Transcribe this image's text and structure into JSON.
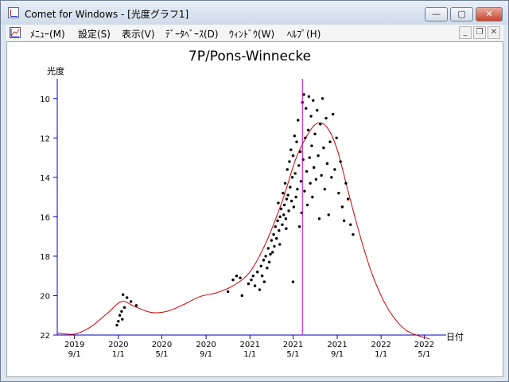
{
  "window": {
    "title": "Comet for Windows - [光度グラフ1]",
    "buttons": {
      "minimize": "—",
      "maximize": "▢",
      "close": "✕"
    }
  },
  "menubar": {
    "items": [
      "ﾒﾆｭｰ(M)",
      "設定(S)",
      "表示(V)",
      "ﾃﾞｰﾀﾍﾞｰｽ(D)",
      "ｳｨﾝﾄﾞｳ(W)",
      "ﾍﾙﾌﾟ(H)"
    ],
    "mdi_buttons": {
      "minimize": "_",
      "restore": "❐",
      "close": "✕"
    }
  },
  "chart_data": {
    "type": "scatter",
    "title": "7P/Pons-Winnecke",
    "ylabel": "光度",
    "xlabel": "日付",
    "y_inverted": true,
    "ylim": [
      22,
      9
    ],
    "y_ticks": [
      10,
      12,
      14,
      16,
      18,
      20,
      22
    ],
    "xlim": [
      "2019-07-15",
      "2022-07-01"
    ],
    "x_ticks": [
      {
        "date": "2019-09-01",
        "year": "2019",
        "md": "9/1"
      },
      {
        "date": "2020-01-01",
        "year": "2020",
        "md": "1/1"
      },
      {
        "date": "2020-05-01",
        "year": "2020",
        "md": "5/1"
      },
      {
        "date": "2020-09-01",
        "year": "2020",
        "md": "9/1"
      },
      {
        "date": "2021-01-01",
        "year": "2021",
        "md": "1/1"
      },
      {
        "date": "2021-05-01",
        "year": "2021",
        "md": "5/1"
      },
      {
        "date": "2021-09-01",
        "year": "2021",
        "md": "9/1"
      },
      {
        "date": "2022-01-01",
        "year": "2022",
        "md": "1/1"
      },
      {
        "date": "2022-05-01",
        "year": "2022",
        "md": "5/1"
      }
    ],
    "marker_line": {
      "date": "2021-05-27",
      "color": "#c000c0"
    },
    "curve_color": "#d00000",
    "axis_color": "#0000c0",
    "curve": [
      {
        "x": "2019-07-15",
        "y": 21.9
      },
      {
        "x": "2019-09-01",
        "y": 21.95
      },
      {
        "x": "2019-10-15",
        "y": 21.6
      },
      {
        "x": "2019-12-01",
        "y": 20.9
      },
      {
        "x": "2020-01-10",
        "y": 20.3
      },
      {
        "x": "2020-02-15",
        "y": 20.55
      },
      {
        "x": "2020-04-01",
        "y": 20.85
      },
      {
        "x": "2020-05-15",
        "y": 20.8
      },
      {
        "x": "2020-07-01",
        "y": 20.45
      },
      {
        "x": "2020-08-15",
        "y": 20.05
      },
      {
        "x": "2020-10-01",
        "y": 19.85
      },
      {
        "x": "2020-11-15",
        "y": 19.5
      },
      {
        "x": "2021-01-01",
        "y": 18.8
      },
      {
        "x": "2021-02-15",
        "y": 17.3
      },
      {
        "x": "2021-04-01",
        "y": 15.2
      },
      {
        "x": "2021-05-10",
        "y": 13.0
      },
      {
        "x": "2021-06-15",
        "y": 11.7
      },
      {
        "x": "2021-07-10",
        "y": 11.25
      },
      {
        "x": "2021-08-05",
        "y": 11.5
      },
      {
        "x": "2021-09-01",
        "y": 12.6
      },
      {
        "x": "2021-10-01",
        "y": 14.7
      },
      {
        "x": "2021-11-01",
        "y": 16.8
      },
      {
        "x": "2021-12-01",
        "y": 18.6
      },
      {
        "x": "2022-01-01",
        "y": 20.0
      },
      {
        "x": "2022-02-01",
        "y": 21.0
      },
      {
        "x": "2022-03-15",
        "y": 21.8
      },
      {
        "x": "2022-05-15",
        "y": 22.2
      }
    ],
    "points": [
      [
        "2020-01-01",
        21.3
      ],
      [
        "2020-01-05",
        21.0
      ],
      [
        "2020-01-10",
        20.8
      ],
      [
        "2020-01-12",
        21.2
      ],
      [
        "2020-01-14",
        19.95
      ],
      [
        "2020-01-18",
        20.6
      ],
      [
        "2020-01-25",
        20.1
      ],
      [
        "2020-02-05",
        20.3
      ],
      [
        "2020-02-20",
        20.5
      ],
      [
        "2019-12-28",
        21.5
      ],
      [
        "2020-11-01",
        19.8
      ],
      [
        "2020-11-15",
        19.2
      ],
      [
        "2020-11-25",
        19.0
      ],
      [
        "2020-12-05",
        19.1
      ],
      [
        "2020-12-10",
        20.0
      ],
      [
        "2020-12-28",
        19.4
      ],
      [
        "2021-01-05",
        19.2
      ],
      [
        "2021-01-10",
        19.0
      ],
      [
        "2021-01-15",
        19.5
      ],
      [
        "2021-01-22",
        18.8
      ],
      [
        "2021-01-28",
        19.7
      ],
      [
        "2021-02-01",
        18.5
      ],
      [
        "2021-02-04",
        19.0
      ],
      [
        "2021-02-08",
        18.2
      ],
      [
        "2021-02-10",
        19.3
      ],
      [
        "2021-02-14",
        18.0
      ],
      [
        "2021-02-18",
        18.6
      ],
      [
        "2021-02-21",
        17.6
      ],
      [
        "2021-02-24",
        18.3
      ],
      [
        "2021-02-27",
        17.9
      ],
      [
        "2021-03-02",
        17.2
      ],
      [
        "2021-03-05",
        17.8
      ],
      [
        "2021-03-08",
        16.9
      ],
      [
        "2021-03-10",
        17.5
      ],
      [
        "2021-03-13",
        16.5
      ],
      [
        "2021-03-16",
        17.1
      ],
      [
        "2021-03-19",
        16.2
      ],
      [
        "2021-03-21",
        15.3
      ],
      [
        "2021-03-23",
        16.7
      ],
      [
        "2021-03-26",
        16.0
      ],
      [
        "2021-03-29",
        15.6
      ],
      [
        "2021-04-01",
        16.4
      ],
      [
        "2021-04-03",
        14.8
      ],
      [
        "2021-04-05",
        15.9
      ],
      [
        "2021-04-07",
        15.4
      ],
      [
        "2021-04-09",
        14.3
      ],
      [
        "2021-04-11",
        16.1
      ],
      [
        "2021-04-13",
        15.1
      ],
      [
        "2021-04-15",
        13.6
      ],
      [
        "2021-04-17",
        14.9
      ],
      [
        "2021-04-19",
        15.7
      ],
      [
        "2021-04-21",
        13.2
      ],
      [
        "2021-04-23",
        14.5
      ],
      [
        "2021-04-25",
        12.6
      ],
      [
        "2021-04-27",
        15.2
      ],
      [
        "2021-04-29",
        14.0
      ],
      [
        "2021-05-01",
        12.9
      ],
      [
        "2021-05-03",
        15.5
      ],
      [
        "2021-05-05",
        11.9
      ],
      [
        "2021-05-07",
        13.8
      ],
      [
        "2021-05-09",
        15.0
      ],
      [
        "2021-05-11",
        12.2
      ],
      [
        "2021-05-13",
        14.6
      ],
      [
        "2021-05-15",
        11.1
      ],
      [
        "2021-05-17",
        13.4
      ],
      [
        "2021-05-19",
        16.5
      ],
      [
        "2021-05-21",
        12.7
      ],
      [
        "2021-05-23",
        14.2
      ],
      [
        "2021-05-25",
        15.8
      ],
      [
        "2021-05-27",
        10.2
      ],
      [
        "2021-05-29",
        13.1
      ],
      [
        "2021-05-31",
        9.8
      ],
      [
        "2021-06-02",
        14.7
      ],
      [
        "2021-06-04",
        12.0
      ],
      [
        "2021-06-06",
        10.5
      ],
      [
        "2021-06-08",
        13.7
      ],
      [
        "2021-06-10",
        15.4
      ],
      [
        "2021-06-12",
        11.6
      ],
      [
        "2021-06-14",
        9.9
      ],
      [
        "2021-06-16",
        13.0
      ],
      [
        "2021-06-18",
        14.3
      ],
      [
        "2021-06-20",
        10.9
      ],
      [
        "2021-06-22",
        12.4
      ],
      [
        "2021-06-24",
        15.0
      ],
      [
        "2021-06-26",
        10.1
      ],
      [
        "2021-06-28",
        13.5
      ],
      [
        "2021-07-01",
        11.8
      ],
      [
        "2021-07-04",
        14.1
      ],
      [
        "2021-07-07",
        10.6
      ],
      [
        "2021-07-10",
        12.9
      ],
      [
        "2021-07-13",
        16.1
      ],
      [
        "2021-07-16",
        11.3
      ],
      [
        "2021-07-19",
        13.9
      ],
      [
        "2021-07-22",
        10.0
      ],
      [
        "2021-07-25",
        12.5
      ],
      [
        "2021-07-28",
        14.6
      ],
      [
        "2021-08-01",
        11.0
      ],
      [
        "2021-08-04",
        13.3
      ],
      [
        "2021-08-08",
        15.9
      ],
      [
        "2021-08-12",
        12.2
      ],
      [
        "2021-08-16",
        14.0
      ],
      [
        "2021-08-20",
        10.8
      ],
      [
        "2021-08-25",
        13.6
      ],
      [
        "2021-08-30",
        12.0
      ],
      [
        "2021-09-05",
        14.8
      ],
      [
        "2021-09-10",
        13.2
      ],
      [
        "2021-09-15",
        15.5
      ],
      [
        "2021-09-20",
        16.2
      ],
      [
        "2021-09-25",
        14.3
      ],
      [
        "2021-10-01",
        15.1
      ],
      [
        "2021-10-08",
        16.4
      ],
      [
        "2021-10-15",
        16.9
      ],
      [
        "2021-05-01",
        19.3
      ],
      [
        "2021-04-12",
        16.6
      ],
      [
        "2021-03-25",
        17.4
      ]
    ]
  }
}
